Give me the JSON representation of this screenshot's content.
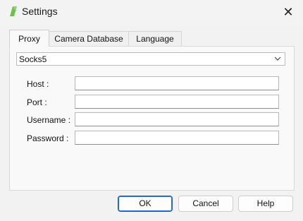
{
  "window": {
    "title": "Settings",
    "app_icon": "green-leaf-icon",
    "close_icon": "close-icon",
    "close_glyph": "✕"
  },
  "tabs": [
    {
      "label": "Proxy",
      "active": true
    },
    {
      "label": "Camera Database",
      "active": false
    },
    {
      "label": "Language",
      "active": false
    }
  ],
  "proxy": {
    "type_selected": "Socks5",
    "fields": [
      {
        "label": "Host :",
        "value": ""
      },
      {
        "label": "Port :",
        "value": ""
      },
      {
        "label": "Username :",
        "value": ""
      },
      {
        "label": "Password :",
        "value": ""
      }
    ]
  },
  "buttons": {
    "ok": "OK",
    "cancel": "Cancel",
    "help": "Help"
  },
  "colors": {
    "accent": "#1f5fb5",
    "app_icon_green": "#6cc24a"
  }
}
